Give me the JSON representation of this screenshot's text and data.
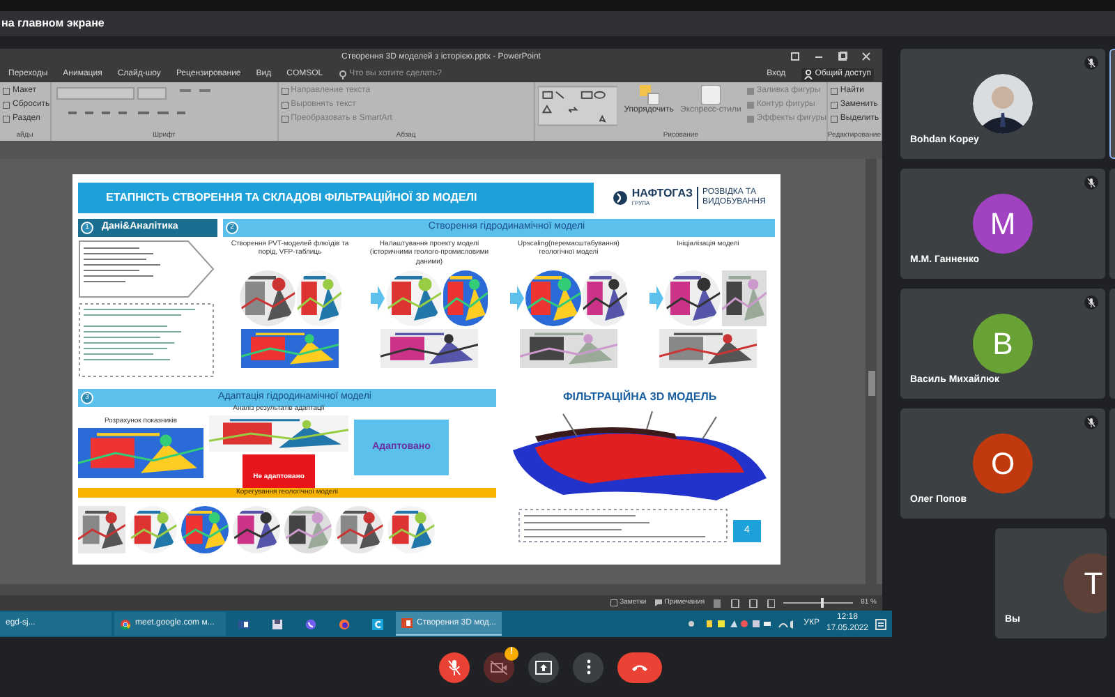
{
  "meet": {
    "banner": "на главном экране"
  },
  "powerpoint": {
    "title": "Створення 3D моделей з історією.pptx - PowerPoint",
    "menu_tabs": [
      "Переходы",
      "Анимация",
      "Слайд-шоу",
      "Рецензирование",
      "Вид",
      "COMSOL"
    ],
    "search_placeholder": "Что вы хотите сделать?",
    "sign_in": "Вход",
    "share": "Общий доступ",
    "ribbon_groups": [
      {
        "label": "айды",
        "items": [
          "Макет",
          "Сбросить",
          "Раздел"
        ]
      },
      {
        "label": "Шрифт"
      },
      {
        "label": "Абзац",
        "items": [
          "Направление текста",
          "Выровнять текст",
          "Преобразовать в SmartArt"
        ]
      },
      {
        "label": "Рисование",
        "items": [
          "Упорядочить",
          "Экспресс-стили",
          "Заливка фигуры",
          "Контур фигуры",
          "Эффекты фигуры"
        ]
      },
      {
        "label": "Редактирование",
        "items": [
          "Найти",
          "Заменить",
          "Выделить"
        ]
      }
    ],
    "slide": {
      "title": "ЕТАПНІСТЬ СТВОРЕННЯ ТА СКЛАДОВІ ФІЛЬТРАЦІЙНОЇ 3D МОДЕЛІ",
      "logo": {
        "name": "НАФТОГАЗ",
        "sub": "ГРУПА",
        "division": "РОЗВІДКА ТА ВИДОБУВАННЯ"
      },
      "sections": [
        {
          "number": "1",
          "title": "Дані&Аналітика"
        },
        {
          "number": "2",
          "title": "Створення гідродинамічної моделі"
        },
        {
          "number": "3",
          "title": "Адаптація гідродинамічної моделі"
        }
      ],
      "steps": [
        "Створення PVT-моделей флюїдів та порід, VFP-таблиць",
        "Налаштування проекту моделі (історичними геолого-промисловими даними)",
        "Upscaling(перемасштабування) геологічної моделі",
        "Ініціалізація моделі"
      ],
      "adaptation": {
        "compute": "Розрахунок показників",
        "analysis": "Аналіз результатів адаптації",
        "ok": "Адаптовано",
        "fail": "Не адаптовано",
        "correction": "Корегування геологічної моделі"
      },
      "model_title": "ФІЛЬТРАЦІЙНА 3D МОДЕЛЬ",
      "page_number": "4"
    },
    "status_bar": {
      "notes": "Заметки",
      "comments": "Примечания",
      "zoom": "81 %",
      "level": 0.55
    }
  },
  "taskbar": {
    "items": [
      {
        "kind": "window",
        "label": "egd-sj...",
        "selected": false
      },
      {
        "kind": "browser",
        "label": "meet.google.com м...",
        "selected": false
      },
      {
        "kind": "word",
        "selected": false
      },
      {
        "kind": "disk",
        "selected": false
      },
      {
        "kind": "phone",
        "selected": false
      },
      {
        "kind": "fox",
        "selected": false
      },
      {
        "kind": "app",
        "selected": false
      },
      {
        "kind": "slides",
        "label": "Створення 3D мод...",
        "selected": true
      }
    ],
    "language": "УКР",
    "time": "12:18",
    "date": "17.05.2022"
  },
  "participants": [
    {
      "name": "Bohdan Kopey",
      "photo": true,
      "muted": true
    },
    {
      "name": "М.М. Ганненко",
      "initial": "М",
      "color": "#a142c1",
      "muted": true
    },
    {
      "name": "Василь Михайлюк",
      "initial": "В",
      "color": "#68a234",
      "muted": true
    },
    {
      "name": "Олег Попов",
      "initial": "О",
      "color": "#c1390e",
      "muted": true
    }
  ],
  "self": {
    "name": "Вы",
    "initial": "Т",
    "color": "#5d4037",
    "muted": false
  },
  "controls": [
    {
      "kind": "mic",
      "on": false
    },
    {
      "kind": "camera",
      "on": false,
      "badge": "!"
    },
    {
      "kind": "present"
    },
    {
      "kind": "more"
    },
    {
      "kind": "hangup"
    }
  ]
}
